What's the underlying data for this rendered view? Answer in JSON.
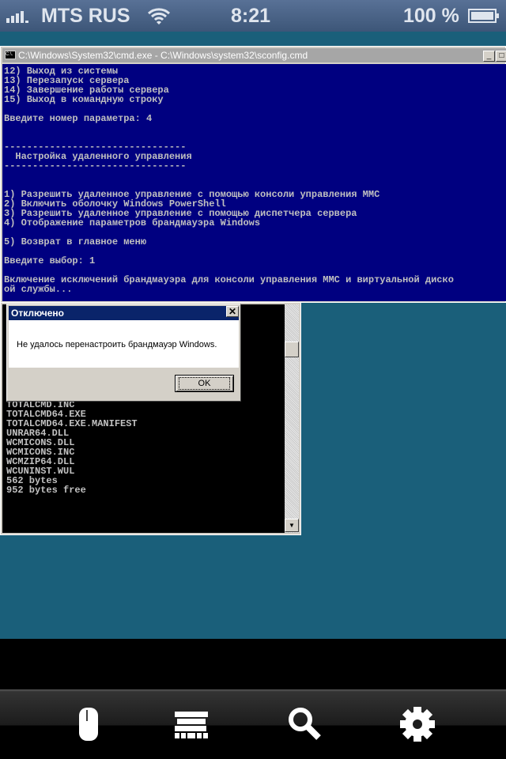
{
  "status_bar": {
    "carrier": "MTS RUS",
    "time": "8:21",
    "battery": "100 %"
  },
  "cmd_window": {
    "title": "C:\\Windows\\System32\\cmd.exe - C:\\Windows\\system32\\sconfig.cmd",
    "icon_label": "C:\\.",
    "lines": [
      "12) Выход из системы",
      "13) Перезапуск сервера",
      "14) Завершение работы сервера",
      "15) Выход в командную строку",
      "",
      "Введите номер параметра: 4",
      "",
      "",
      "--------------------------------",
      "  Настройка удаленного управления",
      "--------------------------------",
      "",
      "",
      "1) Разрешить удаленное управление с помощью консоли управления MMC",
      "2) Включить оболочку Windows PowerShell",
      "3) Разрешить удаленное управление с помощью диспетчера сервера",
      "4) Отображение параметров брандмауэра Windows",
      "",
      "5) Возврат в главное меню",
      "",
      "Введите выбор: 1",
      "",
      "Включение исключений брандмауэра для консоли управления MMC и виртуальной диско",
      "ой службы..."
    ]
  },
  "second_console": {
    "lines": [
      "TOTALCMD.INC",
      "TOTALCMD64.EXE",
      "TOTALCMD64.EXE.MANIFEST",
      "UNRAR64.DLL",
      "WCMICONS.DLL",
      "WCMICONS.INC",
      "WCMZIP64.DLL",
      "WCUNINST.WUL",
      "562 bytes",
      "952 bytes free"
    ]
  },
  "dialog": {
    "title": "Отключено",
    "message": "Не удалось перенастроить брандмауэр Windows.",
    "ok_label": "OK",
    "close_glyph": "✕"
  },
  "toolbar": {
    "items": [
      "mouse-icon",
      "keyboard-icon",
      "search-icon",
      "gear-icon"
    ]
  }
}
